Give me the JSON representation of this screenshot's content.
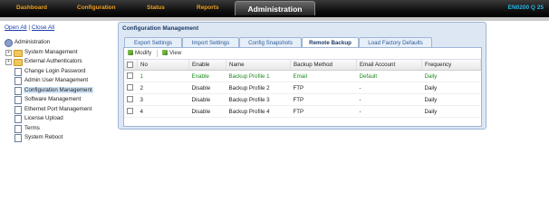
{
  "nav": {
    "items": [
      {
        "label": "Dashboard"
      },
      {
        "label": "Configuration"
      },
      {
        "label": "Status"
      },
      {
        "label": "Reports"
      }
    ],
    "active": "Administration",
    "model": "EN0200 Q 25",
    "colors": {
      "nav_text": "#f0a020",
      "model_text": "#29b6e8"
    }
  },
  "sidebar": {
    "open_all": "Open All",
    "separator": "|",
    "close_all": "Close All",
    "root": "Administration",
    "items": [
      {
        "label": "System Management",
        "type": "folder"
      },
      {
        "label": "External Authenticators",
        "type": "folder"
      },
      {
        "label": "Change Login Password",
        "type": "page"
      },
      {
        "label": "Admin User Management",
        "type": "page"
      },
      {
        "label": "Configuration Management",
        "type": "page",
        "selected": true
      },
      {
        "label": "Software Management",
        "type": "page"
      },
      {
        "label": "Ethernet Port Management",
        "type": "page"
      },
      {
        "label": "License Upload",
        "type": "page"
      },
      {
        "label": "Terms",
        "type": "page"
      },
      {
        "label": "System Reboot",
        "type": "page"
      }
    ]
  },
  "panel": {
    "title": "Configuration Management",
    "tabs": [
      {
        "label": "Export Settings"
      },
      {
        "label": "Import Settings"
      },
      {
        "label": "Config Snapshots"
      },
      {
        "label": "Remote Backup",
        "active": true
      },
      {
        "label": "Load Factory Defaults"
      }
    ],
    "toolbar": {
      "modify": "Modify",
      "view": "View"
    },
    "columns": [
      "No",
      "Enable",
      "Name",
      "Backup Method",
      "Email Account",
      "Frequency"
    ],
    "rows": [
      {
        "no": "1",
        "enable": "Enable",
        "name": "Backup Profile 1",
        "method": "Email",
        "account": "Default",
        "frequency": "Daily",
        "active": true
      },
      {
        "no": "2",
        "enable": "Disable",
        "name": "Backup Profile 2",
        "method": "FTP",
        "account": "-",
        "frequency": "Daily"
      },
      {
        "no": "3",
        "enable": "Disable",
        "name": "Backup Profile 3",
        "method": "FTP",
        "account": "-",
        "frequency": "Daily"
      },
      {
        "no": "4",
        "enable": "Disable",
        "name": "Backup Profile 4",
        "method": "FTP",
        "account": "-",
        "frequency": "Daily"
      }
    ]
  }
}
